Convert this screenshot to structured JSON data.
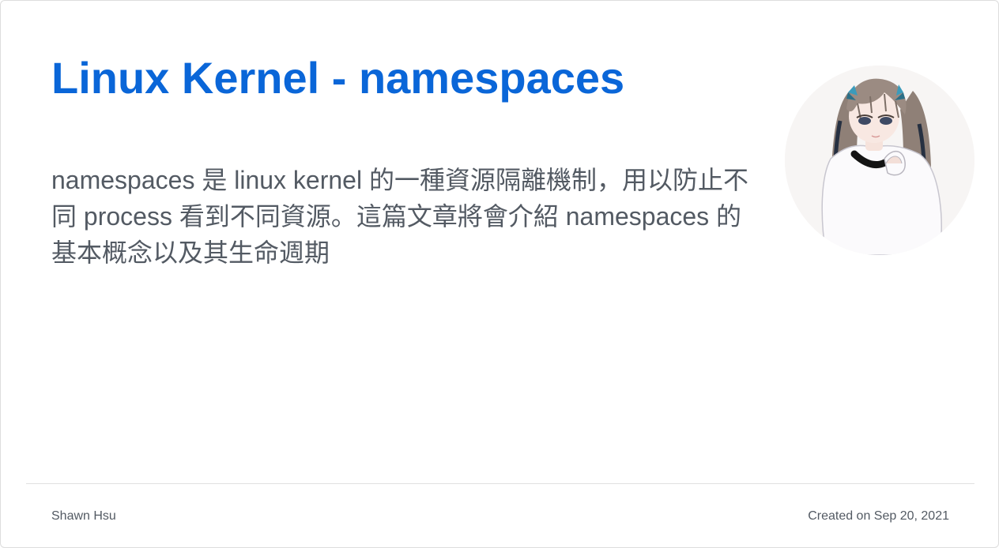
{
  "post": {
    "title": "Linux Kernel - namespaces",
    "description": "namespaces 是 linux kernel 的一種資源隔離機制，用以防止不同 process 看到不同資源。這篇文章將會介紹 namespaces 的基本概念以及其生命週期",
    "author": "Shawn Hsu",
    "created": "Created on Sep 20, 2021"
  },
  "avatar": {
    "icon": "anime-girl-avatar-icon",
    "background_color": "#f7f5f4"
  },
  "colors": {
    "title": "#0a66d8",
    "text": "#535a63",
    "divider": "#e0e0e0"
  }
}
